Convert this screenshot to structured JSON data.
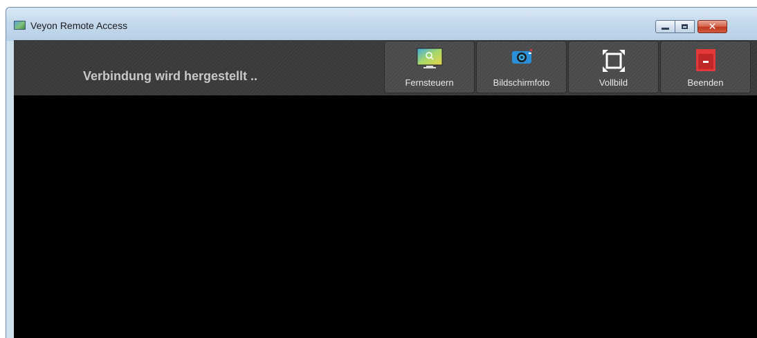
{
  "window": {
    "title": "Veyon Remote Access",
    "controls": {
      "minimize": "minimize",
      "maximize": "maximize",
      "close": "✕"
    }
  },
  "toolbar": {
    "status": "Verbindung wird hergestellt ..",
    "buttons": [
      {
        "label": "Fernsteuern",
        "icon": "monitor-icon"
      },
      {
        "label": "Bildschirmfoto",
        "icon": "camera-icon"
      },
      {
        "label": "Vollbild",
        "icon": "fullscreen-icon"
      },
      {
        "label": "Beenden",
        "icon": "exit-icon"
      }
    ]
  },
  "colors": {
    "toolbar_bg": "#3a3a3a",
    "view_bg": "#000000",
    "exit_red": "#e23a3a",
    "camera_blue": "#2b8fd8"
  }
}
